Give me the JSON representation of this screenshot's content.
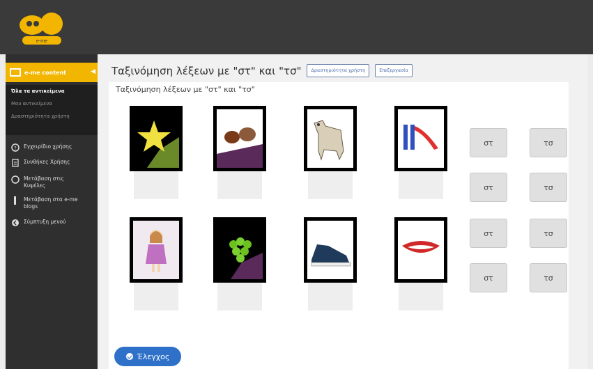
{
  "header": {
    "logo_icon": "emel-logo-icon",
    "logo_text": "e-me"
  },
  "sidebar": {
    "section_label": "e-me content",
    "sub_items": [
      {
        "label": "Όλα τα αντικείμενα",
        "active": true
      },
      {
        "label": "Μου αντικείμενα",
        "active": false
      },
      {
        "label": "Δραστηριότητα χρήστη",
        "active": false
      }
    ],
    "items": [
      {
        "label": "Εγχειρίδιο χρήσης",
        "icon": "help-circle-icon"
      },
      {
        "label": "Συνθήκες Χρήσης",
        "icon": "document-icon"
      },
      {
        "label": "Μετάβαση στις Κυψέλες",
        "icon": "hive-icon"
      },
      {
        "label": "Μετάβαση στα e-me blogs",
        "icon": "blog-icon"
      },
      {
        "label": "Σύμπτυξη μενού",
        "icon": "collapse-icon"
      }
    ]
  },
  "main": {
    "title": "Ταξινόμηση λέξεων με \"στ\" και \"τσ\"",
    "chips": [
      "Δραστηριότητα χρήστη",
      "Επεξεργασία"
    ],
    "panel_title": "Ταξινόμηση λέξεων με \"στ\" και \"τσ\"",
    "cards": [
      {
        "icon": "star-icon"
      },
      {
        "icon": "chestnuts-icon"
      },
      {
        "icon": "goat-icon"
      },
      {
        "icon": "slide-icon"
      },
      {
        "icon": "doll-icon"
      },
      {
        "icon": "grapes-icon"
      },
      {
        "icon": "sneaker-icon"
      },
      {
        "icon": "lips-icon"
      }
    ],
    "sort_buttons": [
      {
        "left": "στ",
        "right": "τσ"
      },
      {
        "left": "στ",
        "right": "τσ"
      },
      {
        "left": "στ",
        "right": "τσ"
      },
      {
        "left": "στ",
        "right": "τσ"
      }
    ],
    "check_button": "Έλεγχος"
  },
  "colors": {
    "accent": "#f2b600",
    "primary": "#2f71c9",
    "topbar": "#3a3a3a",
    "sidebar": "#2f2f2f"
  }
}
